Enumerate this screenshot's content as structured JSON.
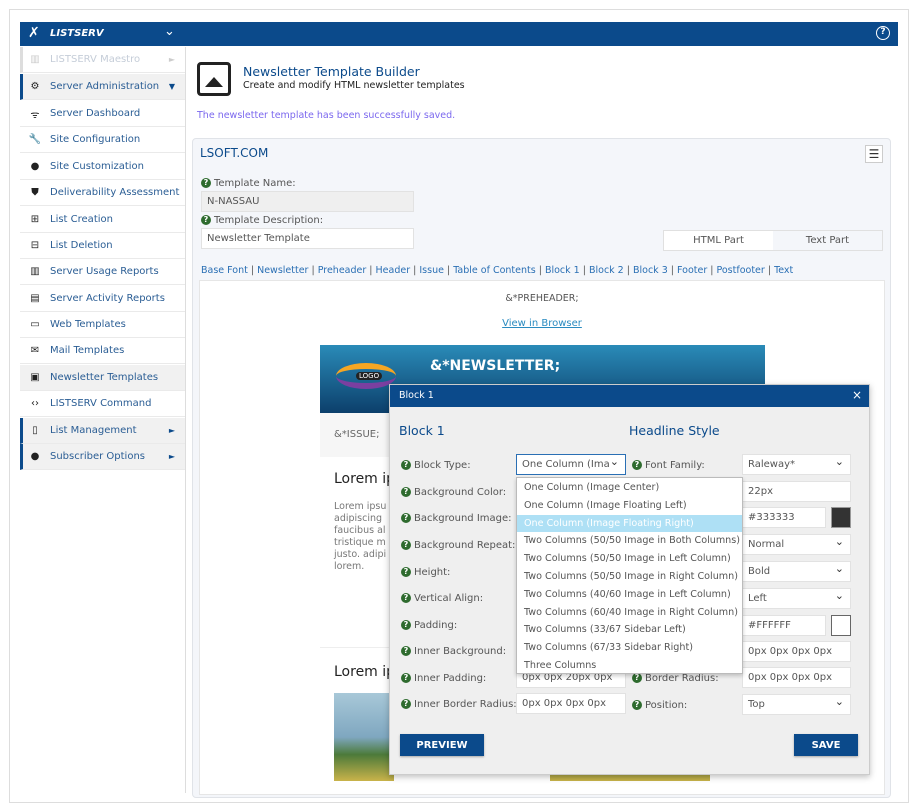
{
  "app": {
    "brand": "LISTSERV",
    "help_icon": "question-circle-icon"
  },
  "sidebar": {
    "items": [
      {
        "label": "LISTSERV Maestro",
        "icon": "chart-icon",
        "type": "group-disabled"
      },
      {
        "label": "Server Administration",
        "icon": "gear-icon",
        "type": "group-open"
      },
      {
        "label": "Server Dashboard",
        "icon": "wifi-icon"
      },
      {
        "label": "Site Configuration",
        "icon": "wrench-icon"
      },
      {
        "label": "Site Customization",
        "icon": "palette-icon"
      },
      {
        "label": "Deliverability Assessment",
        "icon": "shield-check-icon"
      },
      {
        "label": "List Creation",
        "icon": "file-plus-icon"
      },
      {
        "label": "List Deletion",
        "icon": "file-minus-icon"
      },
      {
        "label": "Server Usage Reports",
        "icon": "bar-chart-icon"
      },
      {
        "label": "Server Activity Reports",
        "icon": "clipboard-icon"
      },
      {
        "label": "Web Templates",
        "icon": "monitor-icon"
      },
      {
        "label": "Mail Templates",
        "icon": "envelope-icon"
      },
      {
        "label": "Newsletter Templates",
        "icon": "image-icon",
        "active": true
      },
      {
        "label": "LISTSERV Command",
        "icon": "code-icon"
      },
      {
        "label": "List Management",
        "icon": "file-icon",
        "type": "group"
      },
      {
        "label": "Subscriber Options",
        "icon": "user-icon",
        "type": "group"
      }
    ]
  },
  "page": {
    "title": "Newsletter Template Builder",
    "subtitle": "Create and modify HTML newsletter templates",
    "success": "The newsletter template has been successfully saved.",
    "success_color": "#7b68ee"
  },
  "panel": {
    "site": "LSOFT.COM",
    "name_label": "Template Name:",
    "name_value": "N-NASSAU",
    "desc_label": "Template Description:",
    "desc_value": "Newsletter Template",
    "tabs": [
      "HTML Part",
      "Text Part"
    ],
    "links": [
      "Base Font",
      "Newsletter",
      "Preheader",
      "Header",
      "Issue",
      "Table of Contents",
      "Block 1",
      "Block 2",
      "Block 3",
      "Footer",
      "Postfooter",
      "Text"
    ]
  },
  "preview": {
    "preheader": "&*PREHEADER;",
    "view_browser": "View in Browser",
    "newsletter": "&*NEWSLETTER;",
    "logo": "LOGO",
    "issue": "&*ISSUE;",
    "heading1": "Lorem ip",
    "body1": [
      "Lorem ipsu",
      "adipiscing",
      "faucibus al",
      "tristique m",
      "justo. adipi",
      "lorem."
    ],
    "heading2": "Lorem ip"
  },
  "modal": {
    "title": "Block 1",
    "left_heading": "Block 1",
    "right_heading": "Headline Style",
    "left_labels": [
      "Block Type:",
      "Background Color:",
      "Background Image:",
      "Background Repeat:",
      "Height:",
      "Vertical Align:",
      "Padding:",
      "Inner Background:",
      "Inner Padding:",
      "Inner Border Radius:"
    ],
    "block_type_value": "One Column (Ima",
    "inner_padding": "0px 0px 20px 0px",
    "inner_border_radius": "0px 0px 0px 0px",
    "right_labels": {
      "font_family": "Font Family:",
      "border_radius": "Border Radius:",
      "position": "Position:"
    },
    "right_values": {
      "font_family": "Raleway*",
      "font_size": "22px",
      "color": "#333333",
      "style": "Normal",
      "weight": "Bold",
      "align": "Left",
      "bg": "#FFFFFF",
      "padding": "0px 0px 0px 0px",
      "border_radius": "0px 0px 0px 0px",
      "position": "Top"
    },
    "swatches": {
      "color": "#333333",
      "bg": "#FFFFFF"
    },
    "options": [
      "One Column (Image Center)",
      "One Column (Image Floating Left)",
      "One Column (Image Floating Right)",
      "Two Columns (50/50 Image in Both Columns)",
      "Two Columns (50/50 Image in Left Column)",
      "Two Columns (50/50 Image in Right Column)",
      "Two Columns (40/60 Image in Left Column)",
      "Two Columns (60/40 Image in Right Column)",
      "Two Columns (33/67 Sidebar Left)",
      "Two Columns (67/33 Sidebar Right)",
      "Three Columns"
    ],
    "highlighted_option": "One Column (Image Floating Right)",
    "preview_btn": "PREVIEW",
    "save_btn": "SAVE"
  },
  "colors": {
    "primary": "#0b4a8b",
    "highlight": "#aee0f5"
  }
}
